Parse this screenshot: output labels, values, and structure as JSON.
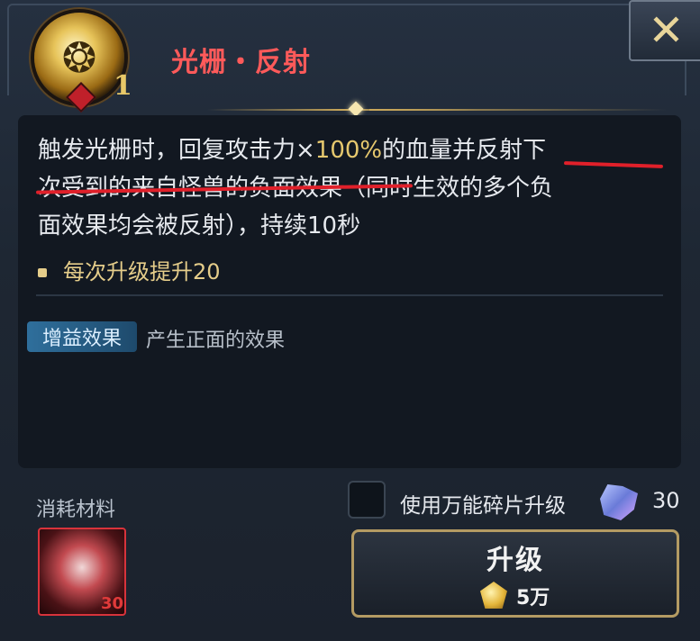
{
  "header": {
    "skill_title": "光栅・反射",
    "skill_level": "1",
    "close_glyph": "✕",
    "skill_icon": "dragon-emblem-icon"
  },
  "description": {
    "line1_a": "触发光栅时，回复攻击力×",
    "line1_num": "100%",
    "line1_b": "的血量并反射下",
    "line2": "次受到的来自怪兽的负面效果（同时生效的多个负",
    "line3": "面效果均会被反射），持续10秒",
    "bonus": "每次升级提升20",
    "tag_label": "增益效果",
    "tag_desc": "产生正面的效果"
  },
  "materials": {
    "label": "消耗材料",
    "item_count": "30",
    "item_icon": "red-puzzle-shard-icon"
  },
  "options": {
    "universal_shard_label": "使用万能碎片升级",
    "universal_shard_checked": false,
    "shard_count": "30",
    "shard_icon": "puzzle-shard-icon"
  },
  "upgrade": {
    "label": "升级",
    "cost": "5万",
    "coin_icon": "gold-pentagon-coin-icon"
  },
  "colors": {
    "title_red": "#ff5a5a",
    "highlight_gold": "#e6c86e",
    "annotation_red": "#e0202a",
    "button_border": "#b49b63"
  }
}
